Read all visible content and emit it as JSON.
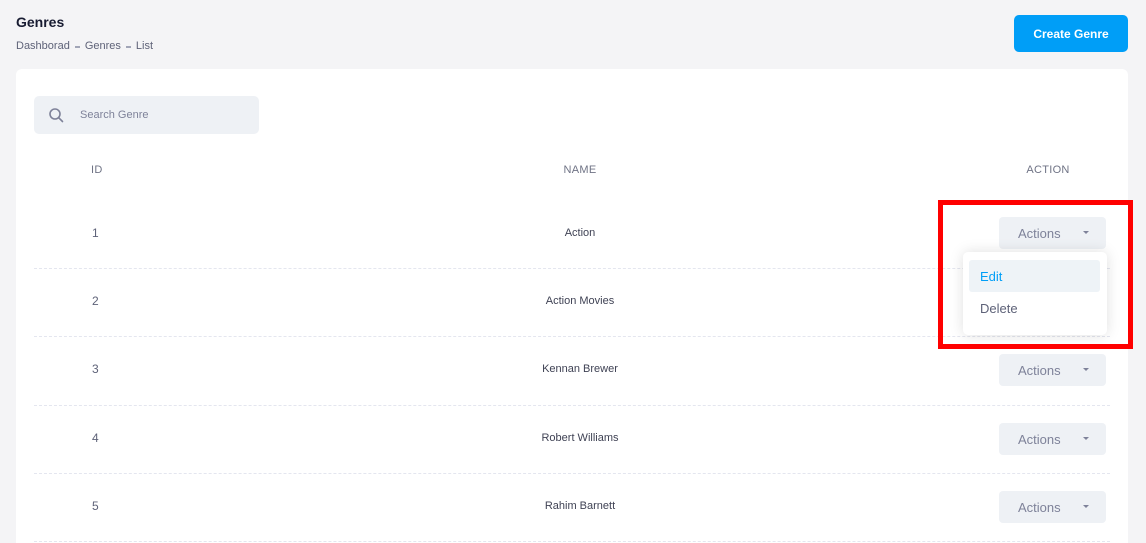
{
  "header": {
    "title": "Genres",
    "breadcrumb": [
      "Dashborad",
      "Genres",
      "List"
    ],
    "create_button": "Create Genre"
  },
  "search": {
    "placeholder": "Search Genre",
    "value": ""
  },
  "table": {
    "columns": [
      "ID",
      "NAME",
      "ACTION"
    ],
    "rows": [
      {
        "id": "1",
        "name": "Action",
        "action": "Actions"
      },
      {
        "id": "2",
        "name": "Action Movies",
        "action": "Actions"
      },
      {
        "id": "3",
        "name": "Kennan Brewer",
        "action": "Actions"
      },
      {
        "id": "4",
        "name": "Robert Williams",
        "action": "Actions"
      },
      {
        "id": "5",
        "name": "Rahim Barnett",
        "action": "Actions"
      }
    ]
  },
  "dropdown": {
    "items": [
      "Edit",
      "Delete"
    ],
    "highlighted": "Edit"
  },
  "colors": {
    "accent": "#009ef7",
    "highlight_border": "#ff0000",
    "page_bg": "#f4f4f6"
  }
}
